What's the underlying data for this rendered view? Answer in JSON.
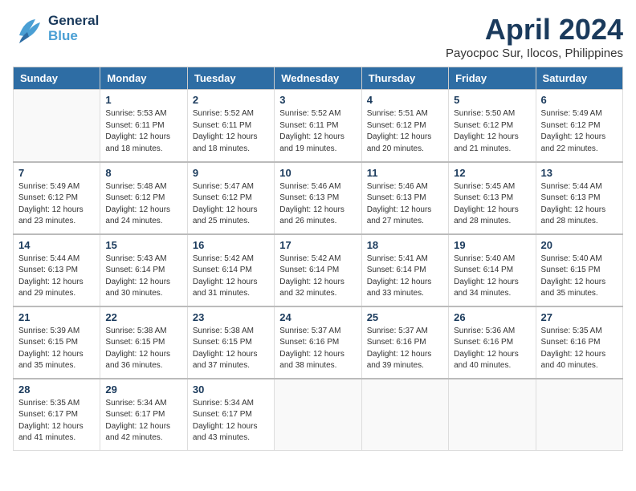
{
  "header": {
    "logo_general": "General",
    "logo_blue": "Blue",
    "month": "April 2024",
    "location": "Payocpoc Sur, Ilocos, Philippines"
  },
  "weekdays": [
    "Sunday",
    "Monday",
    "Tuesday",
    "Wednesday",
    "Thursday",
    "Friday",
    "Saturday"
  ],
  "weeks": [
    [
      {
        "day": "",
        "sunrise": "",
        "sunset": "",
        "daylight": ""
      },
      {
        "day": "1",
        "sunrise": "Sunrise: 5:53 AM",
        "sunset": "Sunset: 6:11 PM",
        "daylight": "Daylight: 12 hours and 18 minutes."
      },
      {
        "day": "2",
        "sunrise": "Sunrise: 5:52 AM",
        "sunset": "Sunset: 6:11 PM",
        "daylight": "Daylight: 12 hours and 18 minutes."
      },
      {
        "day": "3",
        "sunrise": "Sunrise: 5:52 AM",
        "sunset": "Sunset: 6:11 PM",
        "daylight": "Daylight: 12 hours and 19 minutes."
      },
      {
        "day": "4",
        "sunrise": "Sunrise: 5:51 AM",
        "sunset": "Sunset: 6:12 PM",
        "daylight": "Daylight: 12 hours and 20 minutes."
      },
      {
        "day": "5",
        "sunrise": "Sunrise: 5:50 AM",
        "sunset": "Sunset: 6:12 PM",
        "daylight": "Daylight: 12 hours and 21 minutes."
      },
      {
        "day": "6",
        "sunrise": "Sunrise: 5:49 AM",
        "sunset": "Sunset: 6:12 PM",
        "daylight": "Daylight: 12 hours and 22 minutes."
      }
    ],
    [
      {
        "day": "7",
        "sunrise": "Sunrise: 5:49 AM",
        "sunset": "Sunset: 6:12 PM",
        "daylight": "Daylight: 12 hours and 23 minutes."
      },
      {
        "day": "8",
        "sunrise": "Sunrise: 5:48 AM",
        "sunset": "Sunset: 6:12 PM",
        "daylight": "Daylight: 12 hours and 24 minutes."
      },
      {
        "day": "9",
        "sunrise": "Sunrise: 5:47 AM",
        "sunset": "Sunset: 6:12 PM",
        "daylight": "Daylight: 12 hours and 25 minutes."
      },
      {
        "day": "10",
        "sunrise": "Sunrise: 5:46 AM",
        "sunset": "Sunset: 6:13 PM",
        "daylight": "Daylight: 12 hours and 26 minutes."
      },
      {
        "day": "11",
        "sunrise": "Sunrise: 5:46 AM",
        "sunset": "Sunset: 6:13 PM",
        "daylight": "Daylight: 12 hours and 27 minutes."
      },
      {
        "day": "12",
        "sunrise": "Sunrise: 5:45 AM",
        "sunset": "Sunset: 6:13 PM",
        "daylight": "Daylight: 12 hours and 28 minutes."
      },
      {
        "day": "13",
        "sunrise": "Sunrise: 5:44 AM",
        "sunset": "Sunset: 6:13 PM",
        "daylight": "Daylight: 12 hours and 28 minutes."
      }
    ],
    [
      {
        "day": "14",
        "sunrise": "Sunrise: 5:44 AM",
        "sunset": "Sunset: 6:13 PM",
        "daylight": "Daylight: 12 hours and 29 minutes."
      },
      {
        "day": "15",
        "sunrise": "Sunrise: 5:43 AM",
        "sunset": "Sunset: 6:14 PM",
        "daylight": "Daylight: 12 hours and 30 minutes."
      },
      {
        "day": "16",
        "sunrise": "Sunrise: 5:42 AM",
        "sunset": "Sunset: 6:14 PM",
        "daylight": "Daylight: 12 hours and 31 minutes."
      },
      {
        "day": "17",
        "sunrise": "Sunrise: 5:42 AM",
        "sunset": "Sunset: 6:14 PM",
        "daylight": "Daylight: 12 hours and 32 minutes."
      },
      {
        "day": "18",
        "sunrise": "Sunrise: 5:41 AM",
        "sunset": "Sunset: 6:14 PM",
        "daylight": "Daylight: 12 hours and 33 minutes."
      },
      {
        "day": "19",
        "sunrise": "Sunrise: 5:40 AM",
        "sunset": "Sunset: 6:14 PM",
        "daylight": "Daylight: 12 hours and 34 minutes."
      },
      {
        "day": "20",
        "sunrise": "Sunrise: 5:40 AM",
        "sunset": "Sunset: 6:15 PM",
        "daylight": "Daylight: 12 hours and 35 minutes."
      }
    ],
    [
      {
        "day": "21",
        "sunrise": "Sunrise: 5:39 AM",
        "sunset": "Sunset: 6:15 PM",
        "daylight": "Daylight: 12 hours and 35 minutes."
      },
      {
        "day": "22",
        "sunrise": "Sunrise: 5:38 AM",
        "sunset": "Sunset: 6:15 PM",
        "daylight": "Daylight: 12 hours and 36 minutes."
      },
      {
        "day": "23",
        "sunrise": "Sunrise: 5:38 AM",
        "sunset": "Sunset: 6:15 PM",
        "daylight": "Daylight: 12 hours and 37 minutes."
      },
      {
        "day": "24",
        "sunrise": "Sunrise: 5:37 AM",
        "sunset": "Sunset: 6:16 PM",
        "daylight": "Daylight: 12 hours and 38 minutes."
      },
      {
        "day": "25",
        "sunrise": "Sunrise: 5:37 AM",
        "sunset": "Sunset: 6:16 PM",
        "daylight": "Daylight: 12 hours and 39 minutes."
      },
      {
        "day": "26",
        "sunrise": "Sunrise: 5:36 AM",
        "sunset": "Sunset: 6:16 PM",
        "daylight": "Daylight: 12 hours and 40 minutes."
      },
      {
        "day": "27",
        "sunrise": "Sunrise: 5:35 AM",
        "sunset": "Sunset: 6:16 PM",
        "daylight": "Daylight: 12 hours and 40 minutes."
      }
    ],
    [
      {
        "day": "28",
        "sunrise": "Sunrise: 5:35 AM",
        "sunset": "Sunset: 6:17 PM",
        "daylight": "Daylight: 12 hours and 41 minutes."
      },
      {
        "day": "29",
        "sunrise": "Sunrise: 5:34 AM",
        "sunset": "Sunset: 6:17 PM",
        "daylight": "Daylight: 12 hours and 42 minutes."
      },
      {
        "day": "30",
        "sunrise": "Sunrise: 5:34 AM",
        "sunset": "Sunset: 6:17 PM",
        "daylight": "Daylight: 12 hours and 43 minutes."
      },
      {
        "day": "",
        "sunrise": "",
        "sunset": "",
        "daylight": ""
      },
      {
        "day": "",
        "sunrise": "",
        "sunset": "",
        "daylight": ""
      },
      {
        "day": "",
        "sunrise": "",
        "sunset": "",
        "daylight": ""
      },
      {
        "day": "",
        "sunrise": "",
        "sunset": "",
        "daylight": ""
      }
    ]
  ]
}
